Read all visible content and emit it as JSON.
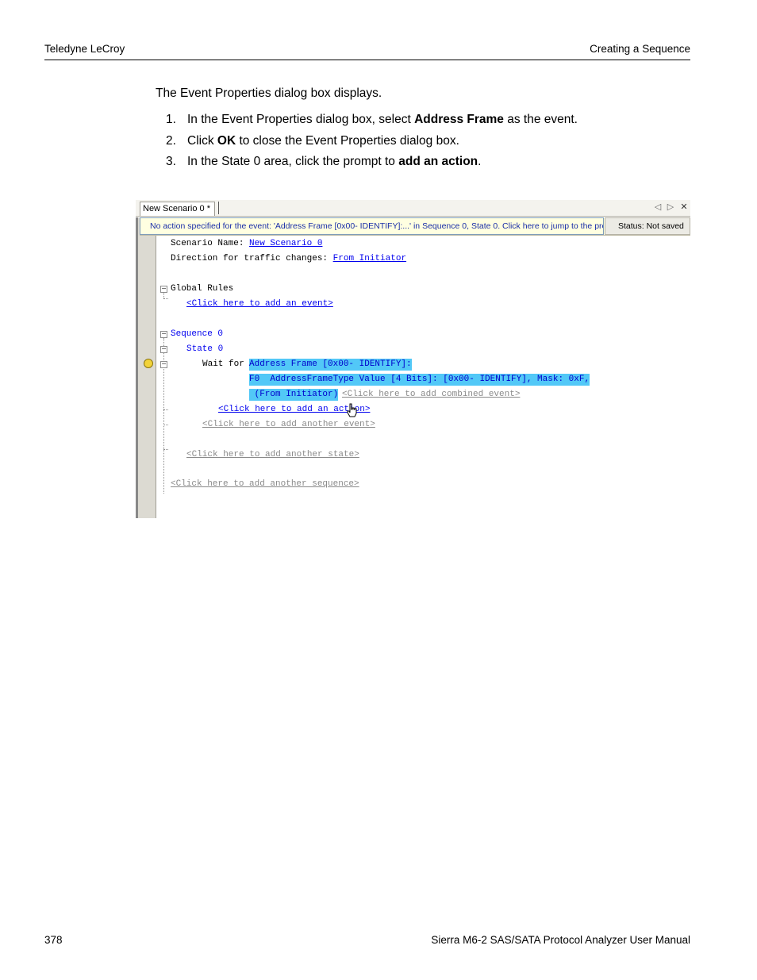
{
  "header": {
    "left": "Teledyne LeCroy",
    "right": "Creating a Sequence"
  },
  "intro": "The Event Properties dialog box displays.",
  "steps": [
    {
      "num": "1.",
      "pre": "In the Event Properties dialog box, select ",
      "bold": "Address Frame",
      "post": " as the event."
    },
    {
      "num": "2.",
      "pre": "Click ",
      "bold": "OK",
      "post": " to close the Event Properties dialog box."
    },
    {
      "num": "3.",
      "pre": "In the State 0 area, click the prompt to ",
      "bold": "add an action",
      "post": "."
    }
  ],
  "screenshot": {
    "tab_label": "New Scenario 0 *",
    "info_message": "No action specified for the event: 'Address Frame [0x00- IDENTIFY]:...' in Sequence 0, State 0.  Click here to jump to the pro...",
    "status": "Status: Not saved",
    "scenario_name_label": "Scenario Name: ",
    "scenario_name_value": "New Scenario 0",
    "direction_label": "Direction for traffic changes: ",
    "direction_value": "From Initiator",
    "global_rules": "Global Rules",
    "add_event": "<Click here to add an event>",
    "sequence": "Sequence 0",
    "state": "State 0",
    "wait_for": "Wait for ",
    "event_line1": "Address Frame [0x00- IDENTIFY]:",
    "event_line2": "F0  AddressFrameType Value [4 Bits]: [0x00- IDENTIFY], Mask: 0xF,",
    "event_line3": " (From Initiator)",
    "add_combined_event": "<Click here to add combined event>",
    "add_action": "<Click here to add an action>",
    "add_another_event": "<Click here to add another event>",
    "add_another_state": "<Click here to add another state>",
    "add_another_sequence": "<Click here to add another sequence>",
    "colors": {
      "selection": "#52c8f7",
      "link": "#0000ee",
      "info_bg": "#ffffe1",
      "info_text": "#1a2ea8"
    }
  },
  "footer": {
    "left": "378",
    "right": "Sierra M6-2 SAS/SATA Protocol Analyzer User Manual"
  }
}
